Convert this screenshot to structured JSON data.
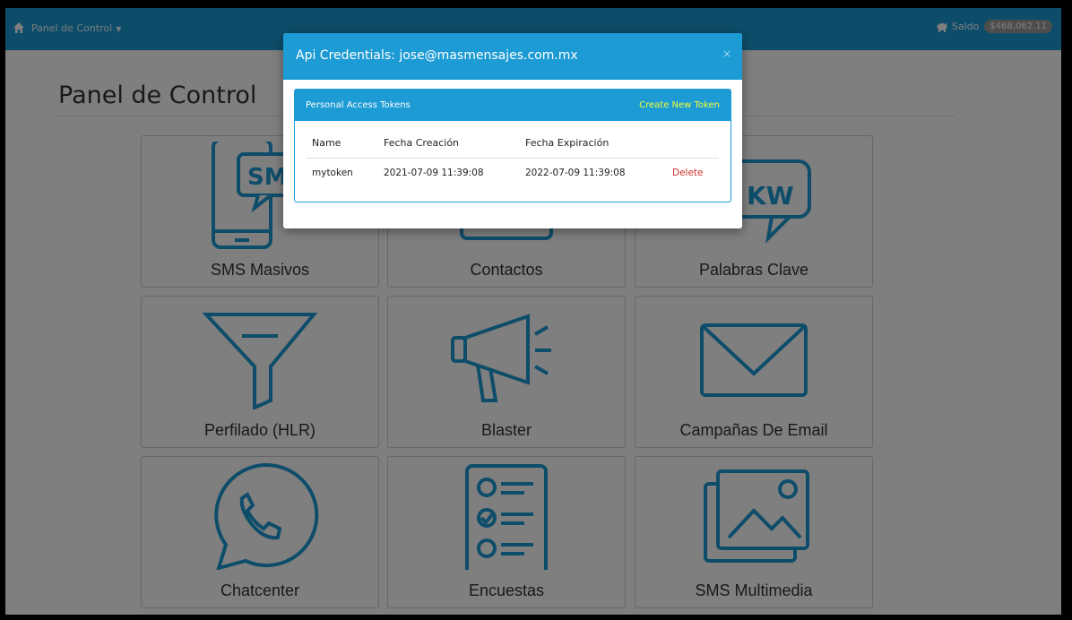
{
  "navbar": {
    "brand": "Panel de Control",
    "saldo_label": "Saldo",
    "saldo_value": "$468,062.11"
  },
  "page": {
    "title": "Panel de Control"
  },
  "cards": [
    {
      "label": "SMS Masivos",
      "icon": "phone-sms-icon"
    },
    {
      "label": "Contactos",
      "icon": "contacts-icon"
    },
    {
      "label": "Palabras Clave",
      "icon": "keyword-bubble-icon"
    },
    {
      "label": "Perfilado (HLR)",
      "icon": "funnel-icon"
    },
    {
      "label": "Blaster",
      "icon": "megaphone-icon"
    },
    {
      "label": "Campañas De Email",
      "icon": "envelope-icon"
    },
    {
      "label": "Chatcenter",
      "icon": "whatsapp-phone-icon"
    },
    {
      "label": "Encuestas",
      "icon": "survey-checklist-icon"
    },
    {
      "label": "SMS Multimedia",
      "icon": "images-icon"
    }
  ],
  "modal": {
    "title": "Api Credentials: jose@masmensajes.com.mx",
    "close": "×",
    "panel_title": "Personal Access Tokens",
    "create_label": "Create New Token",
    "columns": [
      "Name",
      "Fecha Creación",
      "Fecha Expiración"
    ],
    "rows": [
      {
        "name": "mytoken",
        "created": "2021-07-09 11:39:08",
        "expires": "2022-07-09 11:39:08",
        "action": "Delete"
      }
    ]
  },
  "colors": {
    "primary": "#1d9bd4",
    "icon_stroke": "#1d9bd4",
    "create_link": "#f5ff36",
    "delete": "#c9302c"
  }
}
